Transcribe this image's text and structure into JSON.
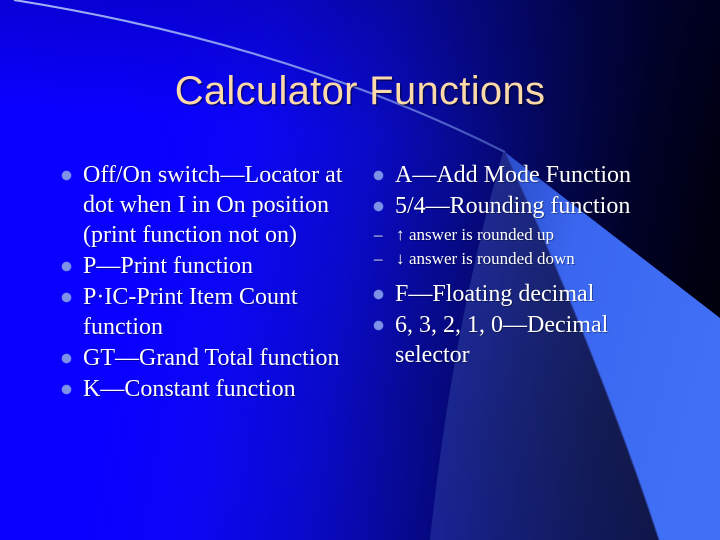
{
  "slide": {
    "title": "Calculator Functions",
    "colors": {
      "title_text": "#FCD9A8",
      "body_text": "#FFFFFF",
      "bullet_marker": "#7C93E8",
      "background_left": "#0A00FF",
      "background_right": "#000006",
      "wedge_accent": "#3A66F0",
      "arc_stroke": "#8FA8F5"
    }
  },
  "left_column": {
    "bullets": [
      {
        "marker": "bullet-dot",
        "text": "Off/On switch—Locator at dot when I in On position (print function not on)"
      },
      {
        "marker": "bullet-dot",
        "text": "P—Print function"
      },
      {
        "marker": "bullet-dot",
        "text": "P·IC-Print Item Count function"
      },
      {
        "marker": "bullet-dot",
        "text": "GT—Grand Total function"
      },
      {
        "marker": "bullet-dot",
        "text": "K—Constant function"
      }
    ]
  },
  "right_column": {
    "bullets": [
      {
        "marker": "bullet-dot",
        "text": "A—Add Mode Function"
      },
      {
        "marker": "bullet-dot",
        "text": "5/4—Rounding function"
      }
    ],
    "sub_bullets": [
      {
        "dash": "–",
        "arrow": "↑",
        "text": "answer is rounded up"
      },
      {
        "dash": "–",
        "arrow": "↓",
        "text": "answer is rounded down"
      }
    ],
    "bullets_after": [
      {
        "marker": "bullet-dot",
        "text": "F—Floating decimal"
      },
      {
        "marker": "bullet-dot",
        "text": "6, 3, 2, 1, 0—Decimal selector"
      }
    ]
  }
}
